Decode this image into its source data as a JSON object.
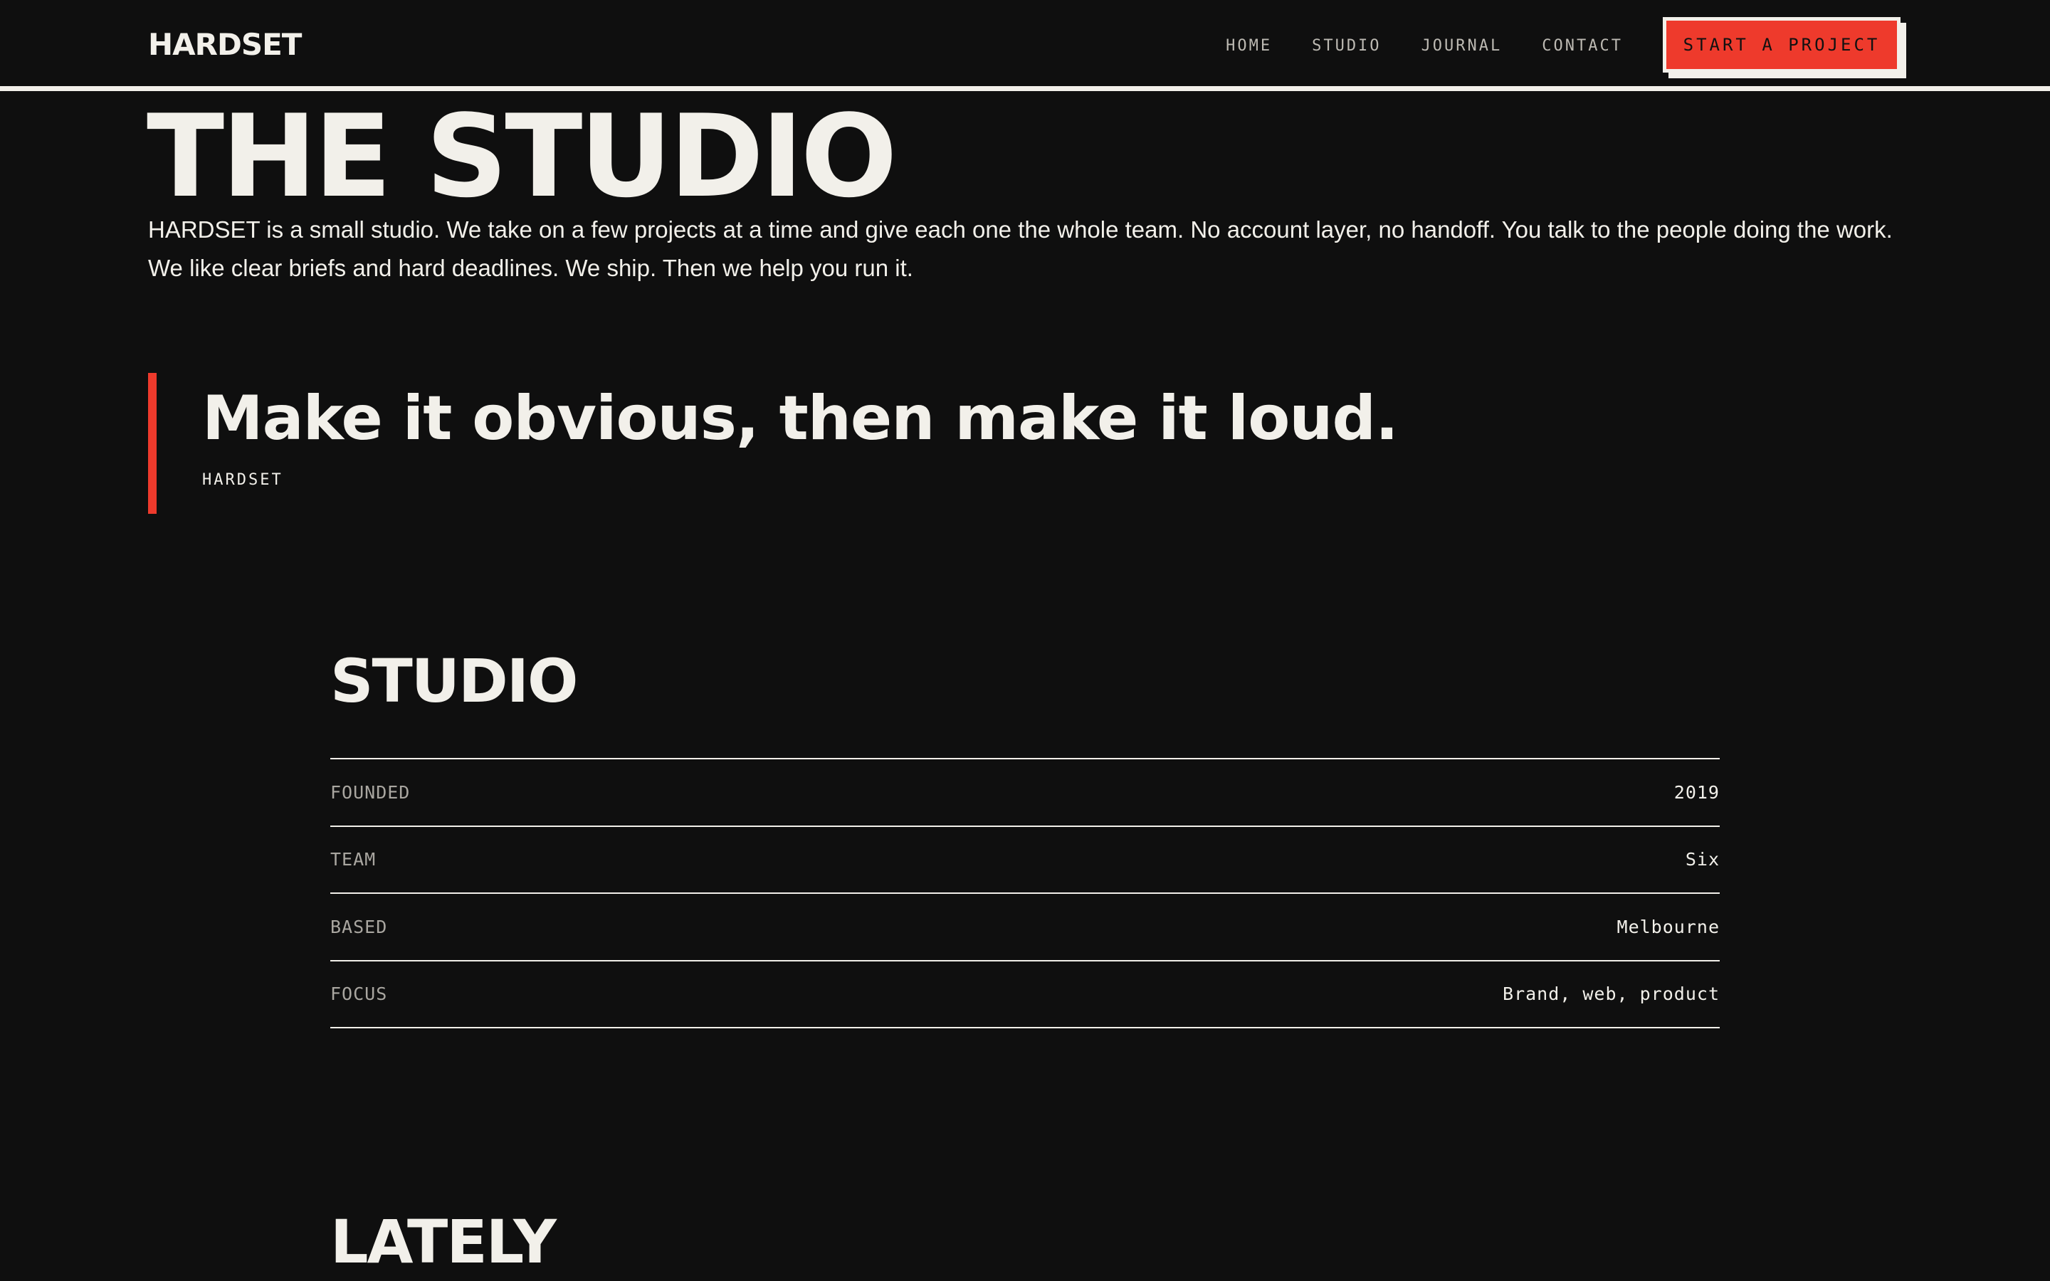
{
  "nav": {
    "logo": "HARDSET",
    "links": [
      "HOME",
      "STUDIO",
      "JOURNAL",
      "CONTACT"
    ],
    "cta_label": "START A PROJECT"
  },
  "hero": {
    "title": "THE STUDIO",
    "paragraphs": [
      "HARDSET is a small studio. We take on a few projects at a time and give each one the whole team. No account layer, no handoff. You talk to the people doing the work.",
      "We like clear briefs and hard deadlines. We ship. Then we help you run it."
    ]
  },
  "quote": {
    "text": "Make it obvious, then make it loud.",
    "attribution": "HARDSET"
  },
  "studio": {
    "title": "STUDIO",
    "facts": [
      {
        "label": "FOUNDED",
        "value": "2019"
      },
      {
        "label": "TEAM",
        "value": "Six"
      },
      {
        "label": "BASED",
        "value": "Melbourne"
      },
      {
        "label": "FOCUS",
        "value": "Brand, web, product"
      }
    ]
  },
  "lately": {
    "title": "LATELY"
  },
  "colors": {
    "background": "#0f0f0f",
    "text": "#f2f0ea",
    "accent": "#ee3a2c"
  }
}
